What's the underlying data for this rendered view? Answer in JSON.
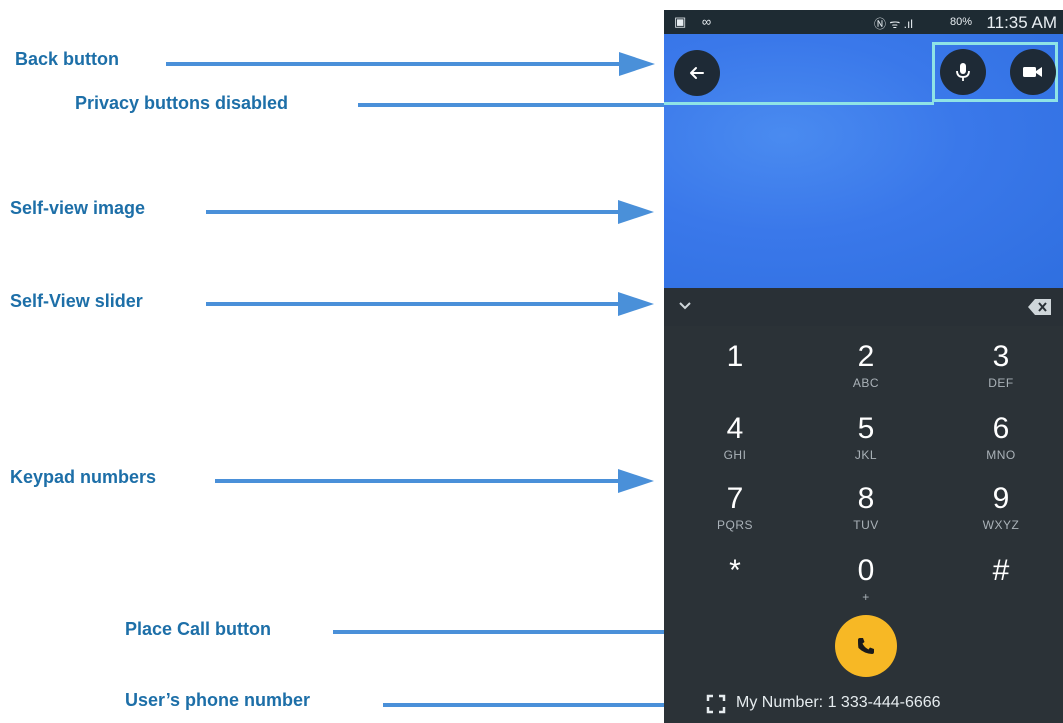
{
  "callouts": {
    "back_button": "Back button",
    "privacy_buttons": "Privacy buttons disabled",
    "self_view_image": "Self-view image",
    "self_view_slider": "Self-View slider",
    "keypad_numbers": "Keypad numbers",
    "place_call_button": "Place Call button",
    "users_phone_number": "User’s phone number"
  },
  "status_bar": {
    "signal_strength": "80%",
    "time": "11:35 AM"
  },
  "keypad": [
    {
      "digit": "1",
      "letters": ""
    },
    {
      "digit": "2",
      "letters": "ABC"
    },
    {
      "digit": "3",
      "letters": "DEF"
    },
    {
      "digit": "4",
      "letters": "GHI"
    },
    {
      "digit": "5",
      "letters": "JKL"
    },
    {
      "digit": "6",
      "letters": "MNO"
    },
    {
      "digit": "7",
      "letters": "PQRS"
    },
    {
      "digit": "8",
      "letters": "TUV"
    },
    {
      "digit": "9",
      "letters": "WXYZ"
    },
    {
      "digit": "*",
      "letters": ""
    },
    {
      "digit": "0",
      "letters": "+"
    },
    {
      "digit": "#",
      "letters": ""
    }
  ],
  "my_number": "My Number: 1 333-444-6666",
  "icons": {
    "back": "back-arrow-icon",
    "mic": "microphone-icon",
    "camera": "video-camera-icon",
    "slider": "chevron-down-icon",
    "backspace": "backspace-icon",
    "call": "phone-icon",
    "number": "my-number-icon"
  },
  "colors": {
    "callout_text": "#1d6fa8",
    "arrow": "#4a90d9",
    "self_view": "#3a78ea",
    "keypad_bg": "#2b3237",
    "call_button": "#f7b825",
    "highlight": "#8fe3e6"
  }
}
